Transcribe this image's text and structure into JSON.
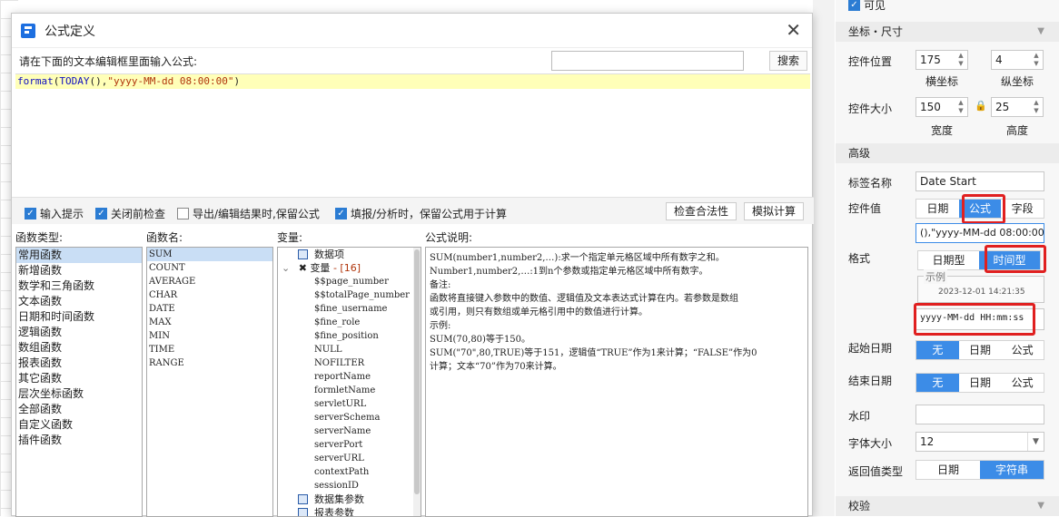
{
  "dialog": {
    "title": "公式定义",
    "hint": "请在下面的文本编辑框里面输入公式:",
    "search_label": "搜索",
    "formula": {
      "fn": "format",
      "open": "(",
      "inner": "TODAY",
      "parens": "()",
      "comma": ",",
      "str": "\"yyyy-MM-dd 08:00:00\"",
      "close": ")"
    },
    "options": [
      {
        "label": "输入提示",
        "checked": true
      },
      {
        "label": "关闭前检查",
        "checked": true
      },
      {
        "label": "导出/编辑结果时,保留公式",
        "checked": false
      },
      {
        "label": "填报/分析时，保留公式用于计算",
        "checked": true
      }
    ],
    "validate_label": "检查合法性",
    "simulate_label": "模拟计算",
    "category_label": "函数类型:",
    "fnname_label": "函数名:",
    "variable_label": "变量:",
    "desc_label": "公式说明:",
    "categories": [
      "常用函数",
      "新增函数",
      "数学和三角函数",
      "文本函数",
      "日期和时间函数",
      "逻辑函数",
      "数组函数",
      "报表函数",
      "其它函数",
      "层次坐标函数",
      "全部函数",
      "自定义函数",
      "插件函数"
    ],
    "functions": [
      "SUM",
      "COUNT",
      "AVERAGE",
      "CHAR",
      "DATE",
      "MAX",
      "MIN",
      "TIME",
      "RANGE"
    ],
    "variables": {
      "data_item": "数据项",
      "var_group": "变量",
      "var_count": "- [16]",
      "list": [
        "$$page_number",
        "$$totalPage_number",
        "$fine_username",
        "$fine_role",
        "$fine_position",
        "NULL",
        "NOFILTER",
        "reportName",
        "formletName",
        "servletURL",
        "serverSchema",
        "serverName",
        "serverPort",
        "serverURL",
        "contextPath",
        "sessionID"
      ],
      "dataset_params": "数据集参数",
      "report_params": "报表参数"
    },
    "description": [
      "SUM(number1,number2,…):求一个指定单元格区域中所有数字之和。",
      "Number1,number2,…:1到n个参数或指定单元格区域中所有数字。",
      "备注:",
      "函数将直接键入参数中的数值、逻辑值及文本表达式计算在内。若参数是数组",
      "或引用，则只有数组或单元格引用中的数值进行计算。",
      "示例:",
      "SUM(70,80)等于150。",
      "SUM(\"70\",80,TRUE)等于151，逻辑值“TRUE”作为1来计算；“FALSE”作为0",
      "计算；文本“70”作为70来计算。"
    ]
  },
  "side": {
    "visible_label": "可见",
    "section_coord": "坐标・尺寸",
    "pos_label": "控件位置",
    "pos_x": "175",
    "pos_y": "4",
    "x_caption": "横坐标",
    "y_caption": "纵坐标",
    "size_label": "控件大小",
    "width": "150",
    "height": "25",
    "w_caption": "宽度",
    "h_caption": "高度",
    "section_adv": "高级",
    "tagname_label": "标签名称",
    "tagname_value": "Date Start",
    "ctlvalue_label": "控件值",
    "ctlvalue_opts": [
      "日期",
      "公式",
      "字段"
    ],
    "ctlvalue_active": 1,
    "ctlvalue_text": "(),\"yyyy-MM-dd 08:00:00\")",
    "format_label": "格式",
    "format_opts": [
      "日期型",
      "时间型"
    ],
    "format_active": 1,
    "example_title": "示例",
    "example_value": "2023-12-01 14:21:35",
    "format_value": "yyyy-MM-dd HH:mm:ss",
    "start_label": "起始日期",
    "start_opts": [
      "无",
      "日期",
      "公式"
    ],
    "end_label": "结束日期",
    "end_opts": [
      "无",
      "日期",
      "公式"
    ],
    "watermark_label": "水印",
    "fontsize_label": "字体大小",
    "fontsize_value": "12",
    "return_label": "返回值类型",
    "return_opts": [
      "日期",
      "字符串"
    ],
    "return_active": 1,
    "section_check": "校验"
  }
}
